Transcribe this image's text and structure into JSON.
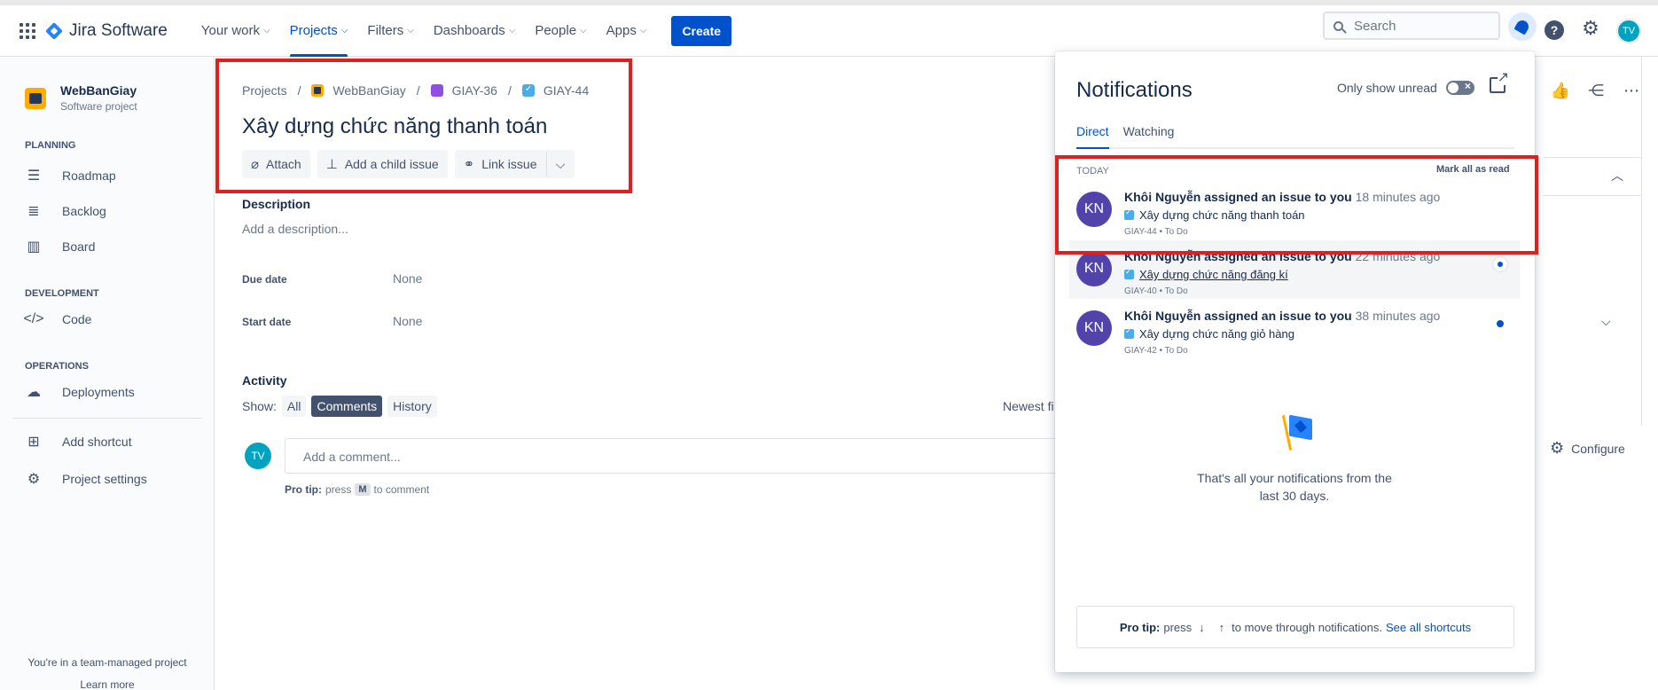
{
  "nav": {
    "app_name": "Jira Software",
    "items": [
      {
        "label": "Your work",
        "active": false
      },
      {
        "label": "Projects",
        "active": true
      },
      {
        "label": "Filters",
        "active": false
      },
      {
        "label": "Dashboards",
        "active": false
      },
      {
        "label": "People",
        "active": false
      },
      {
        "label": "Apps",
        "active": false
      }
    ],
    "create_label": "Create",
    "search_placeholder": "Search",
    "help_glyph": "?",
    "user_initials": "TV"
  },
  "sidebar": {
    "project_name": "WebBanGiay",
    "project_type": "Software project",
    "planning_header": "PLANNING",
    "planning": [
      "Roadmap",
      "Backlog",
      "Board"
    ],
    "development_header": "DEVELOPMENT",
    "development": [
      "Code"
    ],
    "operations_header": "OPERATIONS",
    "operations": [
      "Deployments"
    ],
    "add_shortcut": "Add shortcut",
    "project_settings": "Project settings",
    "footer_text": "You're in a team-managed project",
    "footer_link": "Learn more"
  },
  "issue": {
    "breadcrumb": {
      "projects": "Projects",
      "project": "WebBanGiay",
      "epic": "GIAY-36",
      "issue": "GIAY-44",
      "separator": "/"
    },
    "title": "Xây dựng chức năng thanh toán",
    "actions": {
      "attach": "Attach",
      "add_child": "Add a child issue",
      "link_issue": "Link issue"
    },
    "description_label": "Description",
    "description_placeholder": "Add a description...",
    "due_date_label": "Due date",
    "due_date_value": "None",
    "start_date_label": "Start date",
    "start_date_value": "None",
    "activity_label": "Activity",
    "show_label": "Show:",
    "filters": [
      "All",
      "Comments",
      "History"
    ],
    "active_filter": "Comments",
    "sort_label": "Newest fi",
    "comment_placeholder": "Add a comment...",
    "commenter_initials": "TV",
    "protip_label": "Pro tip:",
    "protip_press": "press",
    "protip_key": "M",
    "protip_suffix": "to comment"
  },
  "right_panel": {
    "configure": "Configure"
  },
  "notifications": {
    "title": "Notifications",
    "only_unread_label": "Only show unread",
    "tabs": [
      "Direct",
      "Watching"
    ],
    "active_tab": "Direct",
    "group_label": "TODAY",
    "mark_all_label": "Mark all as read",
    "items": [
      {
        "initials": "KN",
        "actor": "Khôi Nguyễn assigned an issue to you",
        "time": "18 minutes ago",
        "issue_title": "Xây dựng chức năng thanh toán",
        "meta": "GIAY-44 • To Do",
        "unread": false
      },
      {
        "initials": "KN",
        "actor": "Khôi Nguyễn assigned an issue to you",
        "time": "22 minutes ago",
        "issue_title": "Xây dựng chức năng đăng kí",
        "meta": "GIAY-40 • To Do",
        "unread": true
      },
      {
        "initials": "KN",
        "actor": "Khôi Nguyễn assigned an issue to you",
        "time": "38 minutes ago",
        "issue_title": "Xây dựng chức năng giỏ hàng",
        "meta": "GIAY-42 • To Do",
        "unread": true
      }
    ],
    "empty_message": "That's all your notifications from the last 30 days.",
    "footer": {
      "label": "Pro tip:",
      "press": "press",
      "down": "↓",
      "up": "↑",
      "text": "to move through notifications.",
      "link": "See all shortcuts"
    }
  },
  "colors": {
    "accent": "#0052cc",
    "highlight_box": "#e0201f",
    "avatar_notif": "#5243aa",
    "avatar_user": "#00a3bf"
  }
}
